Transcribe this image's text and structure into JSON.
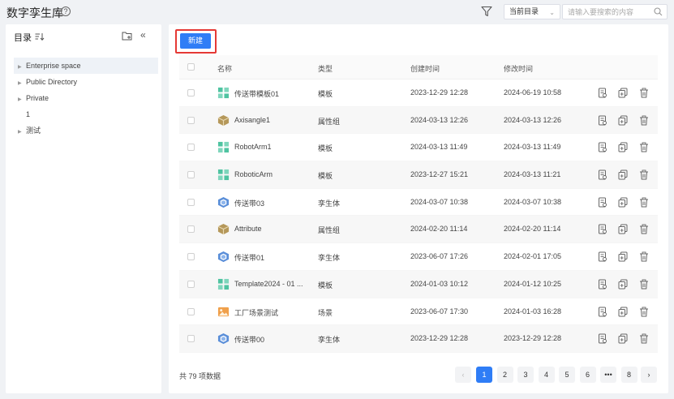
{
  "header": {
    "title": "数字孪生库",
    "help_icon": "?",
    "scope_select": "当前目录",
    "search_placeholder": "请输入要搜索的内容"
  },
  "sidebar": {
    "title": "目录",
    "items": [
      {
        "label": "Enterprise space",
        "has_children": true,
        "active": true
      },
      {
        "label": "Public Directory",
        "has_children": true
      },
      {
        "label": "Private",
        "has_children": true
      },
      {
        "label": "1",
        "has_children": false
      },
      {
        "label": "测试",
        "has_children": true
      }
    ]
  },
  "toolbar": {
    "new_label": "新建"
  },
  "table": {
    "columns": {
      "name": "名称",
      "type": "类型",
      "created": "创建时间",
      "modified": "修改时间"
    },
    "rows": [
      {
        "name": "传送带模板01",
        "type": "模板",
        "created": "2023-12-29 12:28",
        "modified": "2024-06-19 10:58",
        "icon": "template-icon"
      },
      {
        "name": "Axisangle1",
        "type": "属性组",
        "created": "2024-03-13 12:26",
        "modified": "2024-03-13 12:26",
        "icon": "attribute-group-icon"
      },
      {
        "name": "RobotArm1",
        "type": "模板",
        "created": "2024-03-13 11:49",
        "modified": "2024-03-13 11:49",
        "icon": "template-icon"
      },
      {
        "name": "RoboticArm",
        "type": "模板",
        "created": "2023-12-27 15:21",
        "modified": "2024-03-13 11:21",
        "icon": "template-icon"
      },
      {
        "name": "传送带03",
        "type": "孪生体",
        "created": "2024-03-07 10:38",
        "modified": "2024-03-07 10:38",
        "icon": "twin-icon"
      },
      {
        "name": "Attribute",
        "type": "属性组",
        "created": "2024-02-20 11:14",
        "modified": "2024-02-20 11:14",
        "icon": "attribute-group-icon"
      },
      {
        "name": "传送带01",
        "type": "孪生体",
        "created": "2023-06-07 17:26",
        "modified": "2024-02-01 17:05",
        "icon": "twin-icon"
      },
      {
        "name": "Template2024 - 01 ...",
        "type": "模板",
        "created": "2024-01-03 10:12",
        "modified": "2024-01-12 10:25",
        "icon": "template-icon"
      },
      {
        "name": "工厂场景测试",
        "type": "场景",
        "created": "2023-06-07 17:30",
        "modified": "2024-01-03 16:28",
        "icon": "scene-icon"
      },
      {
        "name": "传送带00",
        "type": "孪生体",
        "created": "2023-12-29 12:28",
        "modified": "2023-12-29 12:28",
        "icon": "twin-icon"
      }
    ]
  },
  "footer": {
    "total": "共 79 项数据",
    "pages": [
      "1",
      "2",
      "3",
      "4",
      "5",
      "6",
      "•••",
      "8"
    ],
    "current_page": 1,
    "prev": "‹",
    "next": "›"
  },
  "colors": {
    "primary": "#2f7df6",
    "highlight": "#e53935",
    "template": "#4fc3a1",
    "attribute_group": "#b5985a",
    "twin": "#5b8fd9",
    "scene": "#f0a04b"
  }
}
